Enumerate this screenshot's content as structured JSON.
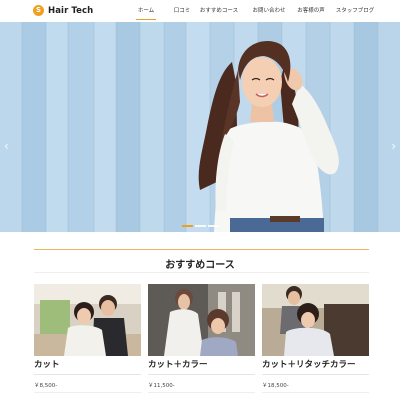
{
  "header": {
    "logo_mark": "S",
    "logo_text": "Hair Tech",
    "nav": [
      {
        "label": "ホーム",
        "active": true
      },
      {
        "label": "口コミ",
        "active": false
      },
      {
        "label": "おすすめコース",
        "active": false
      },
      {
        "label": "お問い合わせ",
        "active": false
      },
      {
        "label": "お客様の声",
        "active": false
      },
      {
        "label": "スタッフブログ",
        "active": false
      }
    ]
  },
  "hero": {
    "slide_count": 3,
    "active_slide": 1,
    "prev_icon": "chevron-left-icon",
    "next_icon": "chevron-right-icon",
    "prev_glyph": "‹",
    "next_glyph": "›"
  },
  "section": {
    "title": "おすすめコース"
  },
  "courses": [
    {
      "title": "カット",
      "price": "￥8,500-"
    },
    {
      "title": "カット＋カラー",
      "price": "￥11,500-"
    },
    {
      "title": "カット＋リタッチカラー",
      "price": "￥18,500-"
    }
  ],
  "colors": {
    "accent": "#f0a020",
    "hero_bg": "#b9d5ea"
  }
}
